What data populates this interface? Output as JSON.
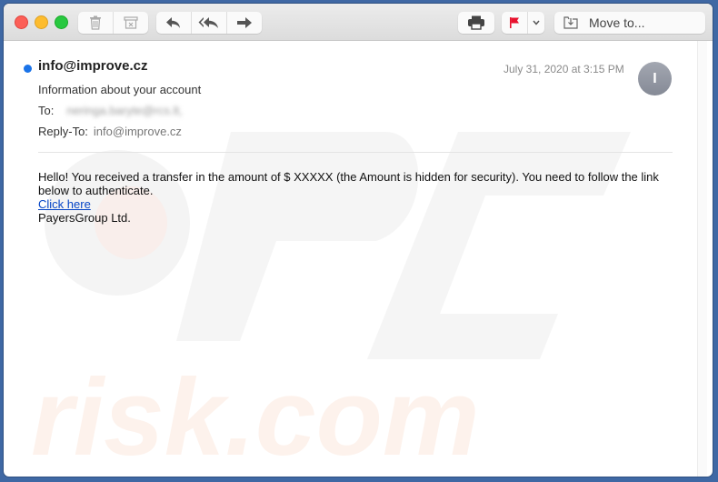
{
  "toolbar": {
    "window_controls": [
      "close",
      "minimize",
      "zoom"
    ],
    "groups": [
      {
        "buttons": [
          {
            "icon": "trash-icon",
            "name": "delete-button"
          },
          {
            "icon": "junk-icon",
            "name": "junk-button"
          }
        ]
      },
      {
        "buttons": [
          {
            "icon": "reply-icon",
            "name": "reply-button"
          },
          {
            "icon": "reply-all-icon",
            "name": "reply-all-button"
          },
          {
            "icon": "forward-icon",
            "name": "forward-button"
          }
        ]
      },
      {
        "buttons": [
          {
            "icon": "print-icon",
            "name": "print-button"
          }
        ]
      },
      {
        "buttons": [
          {
            "icon": "flag-icon",
            "name": "flag-button"
          },
          {
            "icon": "chevron-down-icon",
            "name": "flag-menu-button"
          }
        ]
      }
    ],
    "move_to_label": "Move to...",
    "flag_color": "#e8112d"
  },
  "message": {
    "unread_dot_color": "#1a73e8",
    "from": "info@improve.cz",
    "date": "July 31, 2020 at 3:15 PM",
    "avatar_initial": "I",
    "subject": "Information about your account",
    "to_label": "To:",
    "to_value": "neringa.baryte@rcs.lt,",
    "reply_to_label": "Reply-To:",
    "reply_to_value": "info@improve.cz",
    "body_text": "Hello! You received a transfer in the amount of $ XXXXX (the Amount is hidden for security). You need to follow the link below to authenticate.",
    "link_text": "Click here",
    "signature": "PayersGroup Ltd."
  },
  "watermark": {
    "text": "PC risk.com"
  }
}
